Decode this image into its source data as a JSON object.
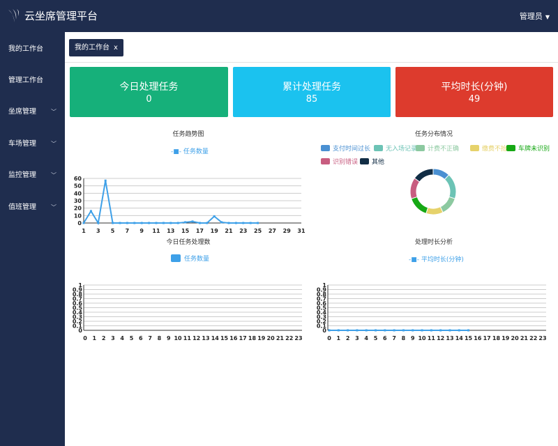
{
  "app": {
    "title": "云坐席管理平台",
    "user": "管理员"
  },
  "sidebar": {
    "items": [
      {
        "label": "我的工作台",
        "expandable": false
      },
      {
        "label": "管理工作台",
        "expandable": false
      },
      {
        "label": "坐席管理",
        "expandable": true
      },
      {
        "label": "车场管理",
        "expandable": true
      },
      {
        "label": "监控管理",
        "expandable": true
      },
      {
        "label": "值班管理",
        "expandable": true
      }
    ]
  },
  "tabs": [
    {
      "label": "我的工作台",
      "close": "x"
    }
  ],
  "cards": [
    {
      "title": "今日处理任务",
      "value": "0",
      "color": "#16b07a"
    },
    {
      "title": "累计处理任务",
      "value": "85",
      "color": "#1bc2ef"
    },
    {
      "title": "平均时长(分钟)",
      "value": "49",
      "color": "#dd3b2d"
    }
  ],
  "chart_data": [
    {
      "type": "line",
      "title": "任务趋势图",
      "series": [
        {
          "name": "任务数量",
          "color": "#3ea0e8",
          "x": [
            1,
            2,
            3,
            4,
            5,
            6,
            7,
            8,
            9,
            10,
            11,
            12,
            13,
            14,
            15,
            16,
            17,
            18,
            19,
            20,
            21,
            22,
            23,
            24,
            25
          ],
          "values": [
            0,
            16,
            0,
            57,
            0,
            0,
            0,
            0,
            0,
            0,
            0,
            0,
            0,
            0,
            1,
            2,
            0,
            0,
            9,
            1,
            0,
            0,
            0,
            0,
            0
          ]
        }
      ],
      "xlim": [
        1,
        31
      ],
      "xticks": [
        1,
        3,
        5,
        7,
        9,
        11,
        13,
        15,
        17,
        19,
        21,
        23,
        25,
        27,
        29,
        31
      ],
      "ylim": [
        0,
        60
      ],
      "yticks": [
        0,
        10,
        20,
        30,
        40,
        50,
        60
      ],
      "xlabel": "",
      "ylabel": "",
      "grid": true,
      "legend": "top"
    },
    {
      "type": "pie",
      "title": "任务分布情况",
      "donut": true,
      "legend": "top",
      "slices": [
        {
          "name": "支付时间过长",
          "value": 12,
          "color": "#4a90d2"
        },
        {
          "name": "无入场记录",
          "value": 18,
          "color": "#6cc3b5"
        },
        {
          "name": "计费不正确",
          "value": 13,
          "color": "#8cc9a0"
        },
        {
          "name": "缴费不抬杆",
          "value": 12,
          "color": "#e6d26b"
        },
        {
          "name": "车牌未识别",
          "value": 15,
          "color": "#16a814"
        },
        {
          "name": "识别错误",
          "value": 15,
          "color": "#c85d80"
        },
        {
          "name": "其他",
          "value": 15,
          "color": "#112d45"
        }
      ]
    },
    {
      "type": "bar",
      "title": "今日任务处理数",
      "series": [
        {
          "name": "任务数量",
          "color": "#3ea0e8",
          "values": [
            0,
            0,
            0,
            0,
            0,
            0,
            0,
            0,
            0,
            0,
            0,
            0,
            0,
            0,
            0,
            0,
            0,
            0,
            0,
            0,
            0,
            0,
            0,
            0
          ]
        }
      ],
      "categories": [
        "0",
        "1",
        "2",
        "3",
        "4",
        "5",
        "6",
        "7",
        "8",
        "9",
        "10",
        "11",
        "12",
        "13",
        "14",
        "15",
        "16",
        "17",
        "18",
        "19",
        "20",
        "21",
        "22",
        "23"
      ],
      "ylim": [
        0,
        1
      ],
      "yticks": [
        "0",
        "0.1",
        "0.2",
        "0.3",
        "0.4",
        "0.5",
        "0.6",
        "0.7",
        "0.8",
        "0.9",
        "1"
      ],
      "xlabel": "",
      "ylabel": "",
      "grid": true,
      "legend": "top"
    },
    {
      "type": "line",
      "title": "处理时长分析",
      "series": [
        {
          "name": "平均时长(分钟)",
          "color": "#3ea0e8",
          "x": [
            0,
            1,
            2,
            3,
            4,
            5,
            6,
            7,
            8,
            9,
            10,
            11,
            12,
            13,
            14,
            15
          ],
          "values": [
            0,
            0,
            0,
            0,
            0,
            0,
            0,
            0,
            0,
            0,
            0,
            0,
            0,
            0,
            0,
            0
          ]
        }
      ],
      "categories": [
        "0",
        "1",
        "2",
        "3",
        "4",
        "5",
        "6",
        "7",
        "8",
        "9",
        "10",
        "11",
        "12",
        "13",
        "14",
        "15",
        "16",
        "17",
        "18",
        "19",
        "20",
        "21",
        "22",
        "23"
      ],
      "ylim": [
        0,
        1
      ],
      "yticks": [
        "0",
        "0.1",
        "0.2",
        "0.3",
        "0.4",
        "0.5",
        "0.6",
        "0.7",
        "0.8",
        "0.9",
        "1"
      ],
      "xlabel": "",
      "ylabel": "",
      "grid": true,
      "legend": "top"
    }
  ]
}
